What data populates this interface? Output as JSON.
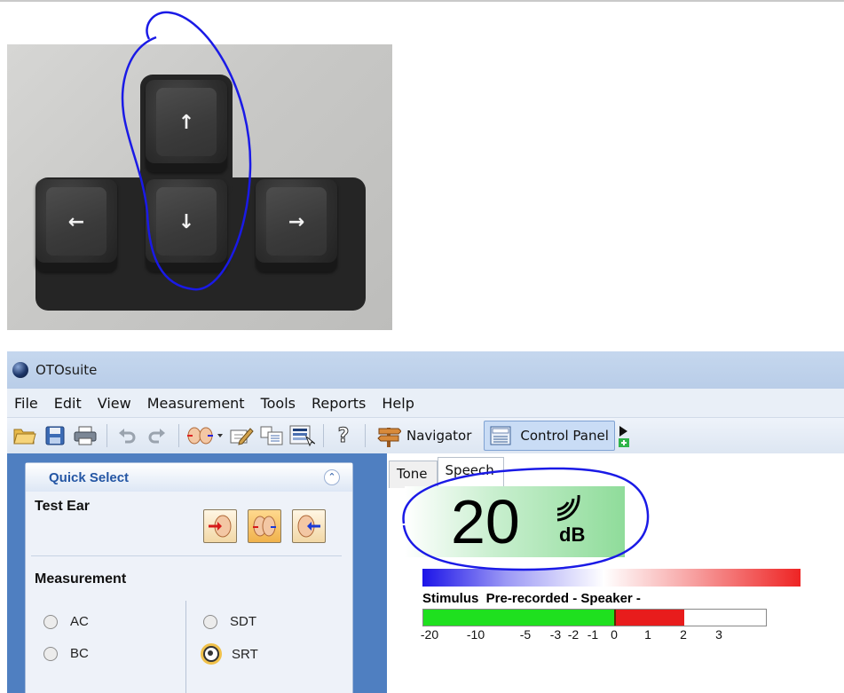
{
  "keyboard": {
    "keys": [
      {
        "name": "up-arrow-key",
        "glyph": "↑"
      },
      {
        "name": "left-arrow-key",
        "glyph": "←"
      },
      {
        "name": "down-arrow-key",
        "glyph": "↓"
      },
      {
        "name": "right-arrow-key",
        "glyph": "→"
      }
    ]
  },
  "app": {
    "title": "OTOsuite",
    "menu": [
      "File",
      "Edit",
      "View",
      "Measurement",
      "Tools",
      "Reports",
      "Help"
    ],
    "toolbar": {
      "navigator_label": "Navigator",
      "control_panel_label": "Control Panel"
    },
    "quick_select": {
      "title": "Quick Select",
      "test_ear_label": "Test Ear",
      "measurement_label": "Measurement",
      "options_left": [
        "AC",
        "BC"
      ],
      "options_right": [
        "SDT",
        "SRT"
      ],
      "selected": "SRT"
    },
    "tabs": [
      "Tone",
      "Speech"
    ],
    "active_tab": "Speech",
    "level": {
      "value": "20",
      "unit": "dB"
    },
    "stimulus_text": "Stimulus  Pre-recorded - Speaker -",
    "vu_scale": [
      "-20",
      "-10",
      "-5",
      "-3",
      "-2",
      "-1",
      "0",
      "1",
      "2",
      "3"
    ],
    "vu_level": 2
  },
  "colors": {
    "annotation": "#1a1ae6",
    "accent": "#4f7fc1"
  }
}
